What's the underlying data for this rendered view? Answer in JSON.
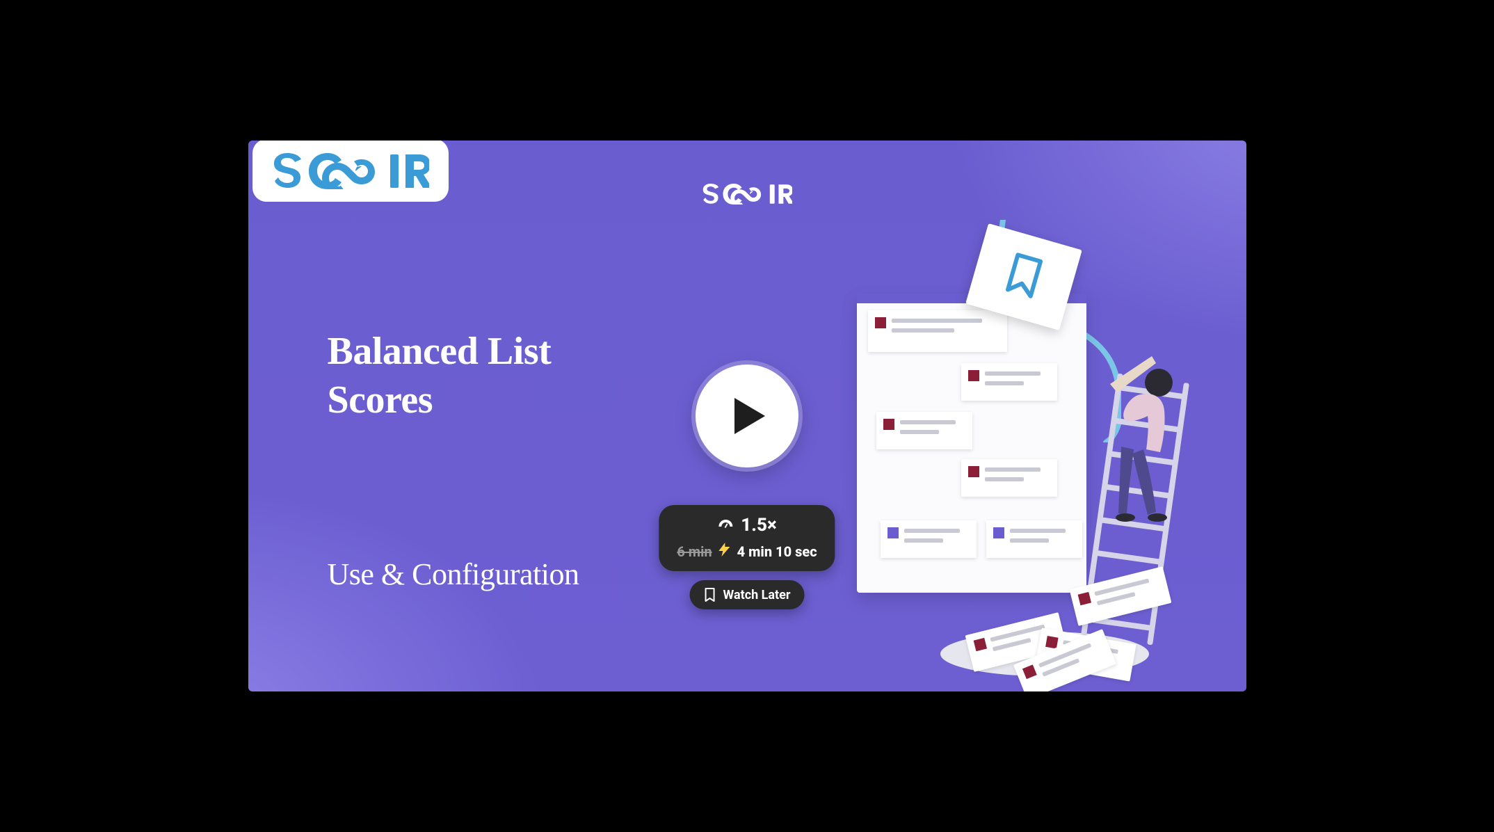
{
  "brand": {
    "name": "SCOIR",
    "accent": "#3a9bd6"
  },
  "thumbnail": {
    "title_line1": "Balanced List",
    "title_line2": "Scores",
    "subtitle": "Use & Configuration",
    "header_logo_text": "SCOIR"
  },
  "playback": {
    "speed_label": "1.5×",
    "original_duration": "6 min",
    "effective_duration": "4 min 10 sec",
    "watch_later_label": "Watch Later"
  },
  "colors": {
    "bg_purple": "#6a5dcf",
    "bg_purple_light": "#8c80e6",
    "pill_bg": "#2a2a2a",
    "accent_red": "#8c1f38"
  }
}
